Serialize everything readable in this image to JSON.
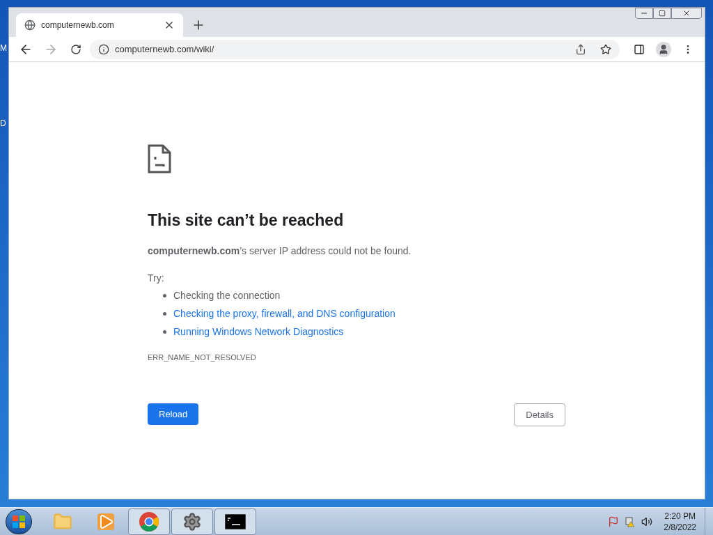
{
  "desktop": {
    "icon_labels": [
      "M",
      "D"
    ]
  },
  "browser": {
    "tabs": [
      {
        "title": "computernewb.com",
        "selected": true
      }
    ],
    "address": "computernewb.com/wiki/",
    "page": {
      "title": "This site can’t be reached",
      "message": "**computernewb.com**’s server IP address could not be found.",
      "try_label": "Try:",
      "suggestions": [
        {
          "kind": "text",
          "text": "Checking the connection"
        },
        {
          "kind": "link",
          "text": "Checking the proxy, firewall, and DNS configuration"
        },
        {
          "kind": "link",
          "text": "Running Windows Network Diagnostics"
        }
      ],
      "error_code": "ERR_NAME_NOT_RESOLVED",
      "buttons": [
        {
          "kind": "primary",
          "label": "Reload"
        },
        {
          "kind": "secondary",
          "label": "Details"
        }
      ]
    }
  },
  "taskbar": {
    "apps": [
      {
        "kind": "folder",
        "open": false
      },
      {
        "kind": "media",
        "open": false
      },
      {
        "kind": "chrome",
        "open": true
      },
      {
        "kind": "gear",
        "open": true
      },
      {
        "kind": "terminal",
        "open": true
      }
    ],
    "clock": {
      "time": "2:20 PM",
      "date": "2/8/2022"
    }
  }
}
